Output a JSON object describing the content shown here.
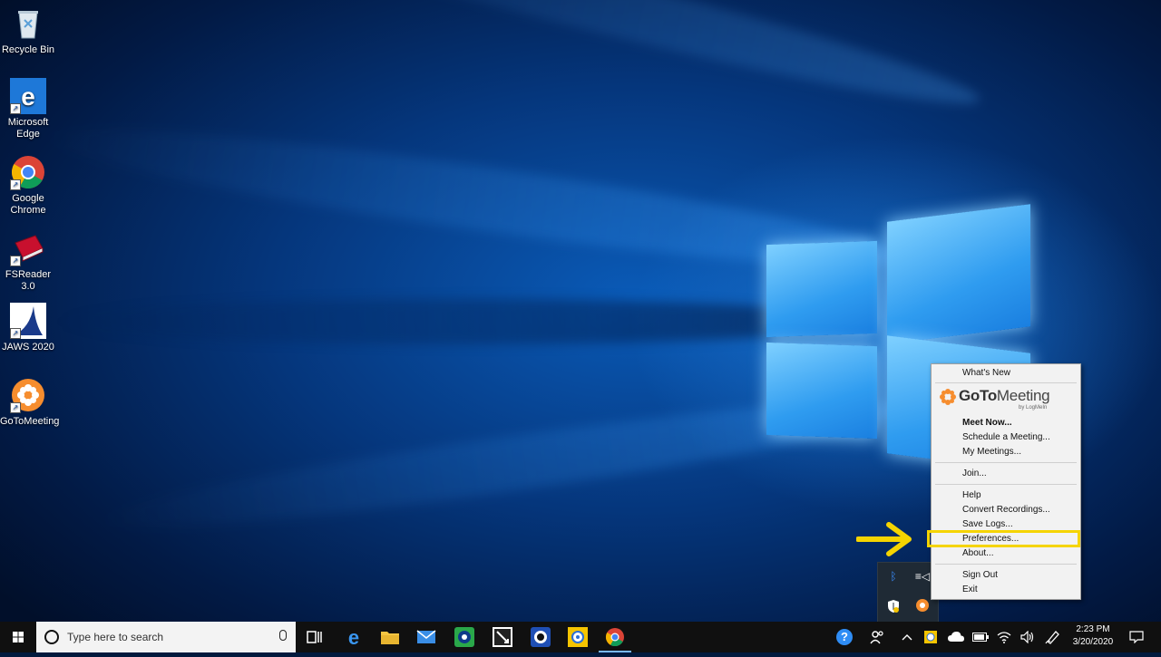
{
  "desktop": {
    "icons": [
      {
        "label": "Recycle Bin"
      },
      {
        "label": "Microsoft\nEdge"
      },
      {
        "label": "Google\nChrome"
      },
      {
        "label": "FSReader 3.0"
      },
      {
        "label": "JAWS 2020"
      },
      {
        "label": "GoToMeeting"
      }
    ]
  },
  "context_menu": {
    "whats_new": "What's New",
    "brand_name_bold": "GoTo",
    "brand_name_rest": "Meeting",
    "brand_sub": "by LogMeIn",
    "items": {
      "meet_now": "Meet Now...",
      "schedule": "Schedule a Meeting...",
      "my_meetings": "My Meetings...",
      "join": "Join...",
      "help": "Help",
      "convert": "Convert Recordings...",
      "save_logs": "Save Logs...",
      "preferences": "Preferences...",
      "about": "About...",
      "sign_out": "Sign Out",
      "exit": "Exit"
    },
    "highlight_color": "#f5d400"
  },
  "taskbar": {
    "search_placeholder": "Type here to search",
    "help_glyph": "?",
    "clock_time": "2:23 PM",
    "clock_date": "3/20/2020"
  },
  "colors": {
    "accent": "#0078d7",
    "gotomeeting_orange": "#f68d2e",
    "arrow_yellow": "#f5d400"
  }
}
